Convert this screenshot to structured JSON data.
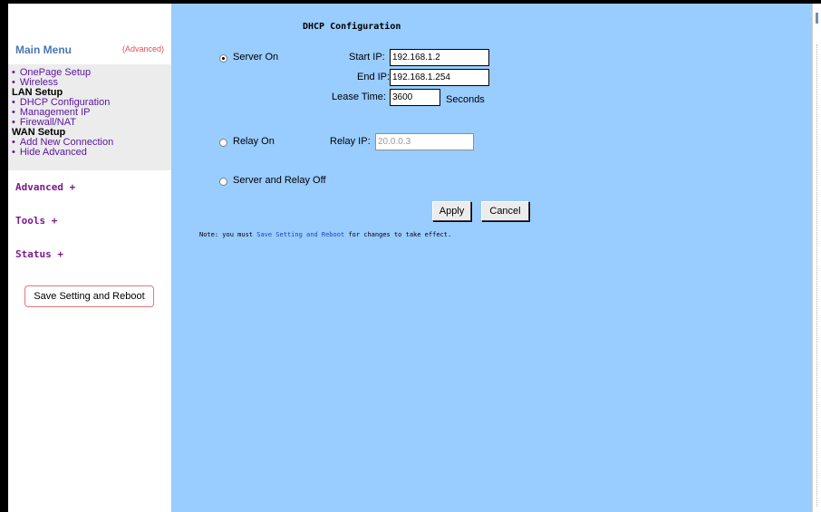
{
  "sidebar": {
    "main_menu": "Main Menu",
    "advanced_link": "(Advanced)",
    "items": [
      {
        "label": "OnePage Setup"
      },
      {
        "label": "Wireless"
      },
      {
        "heading": "LAN Setup"
      },
      {
        "label": "DHCP Configuration"
      },
      {
        "label": "Management IP"
      },
      {
        "label": "Firewall/NAT"
      },
      {
        "heading": "WAN Setup"
      },
      {
        "label": "Add New Connection"
      },
      {
        "label": "Hide Advanced"
      }
    ],
    "sections": [
      "Advanced +",
      "Tools +",
      "Status +"
    ],
    "save_button": "Save Setting and Reboot"
  },
  "main": {
    "title": "DHCP Configuration",
    "server_on": {
      "label": "Server On",
      "selected": true
    },
    "start_ip_label": "Start IP:",
    "start_ip_value": "192.168.1.2",
    "end_ip_label": "End IP:",
    "end_ip_value": "192.168.1.254",
    "lease_time_label": "Lease Time:",
    "lease_time_value": "3600",
    "lease_unit": "Seconds",
    "relay_on": {
      "label": "Relay On",
      "selected": false
    },
    "relay_ip_label": "Relay IP:",
    "relay_ip_value": "20.0.0.3",
    "server_relay_off": {
      "label": "Server and Relay Off",
      "selected": false
    },
    "apply_button": "Apply",
    "cancel_button": "Cancel",
    "note_prefix": "Note: you must",
    "note_link": "Save Setting and Reboot",
    "note_suffix": "for changes to take effect."
  },
  "colors": {
    "main_bg": "#99ccff",
    "menu_link": "#5a14a0",
    "section": "#7a1a8a",
    "main_menu": "#4a78b5",
    "advanced": "#e05050"
  }
}
